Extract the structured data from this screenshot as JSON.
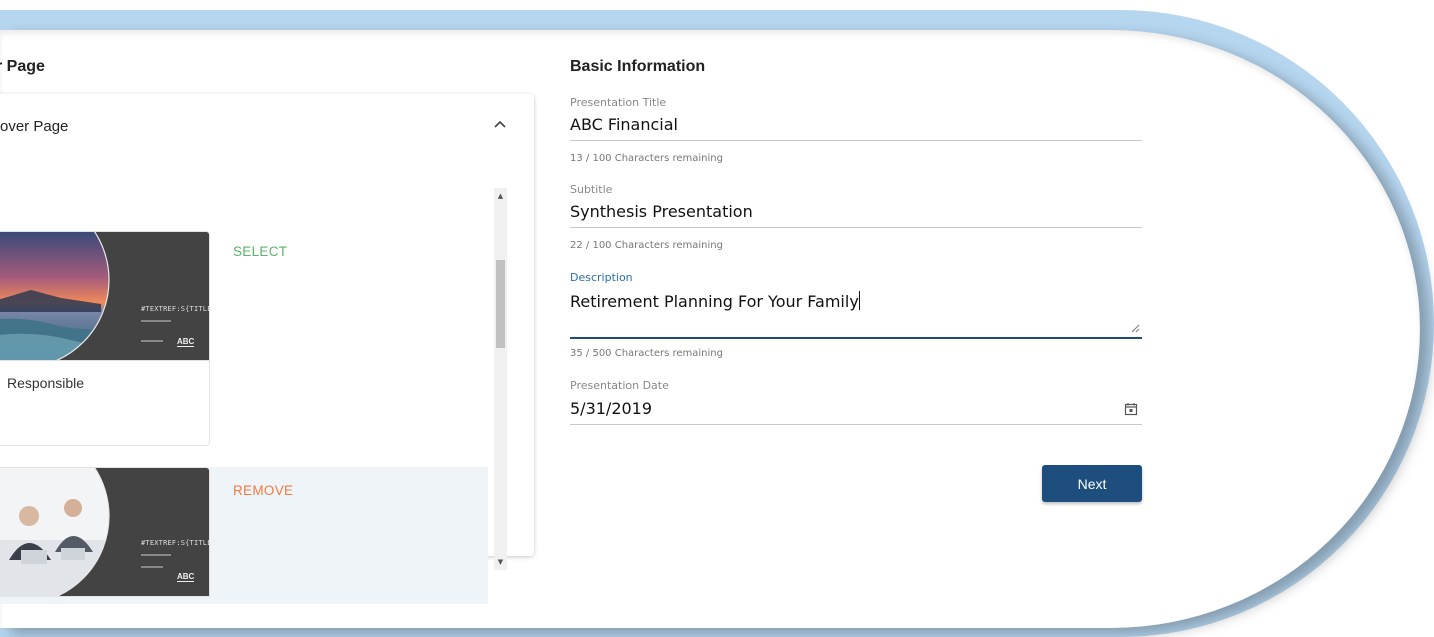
{
  "cover": {
    "section_title": "r Page",
    "panel_title": "over Page",
    "items": [
      {
        "action": "SELECT",
        "action_color": "#5cb36a",
        "caption": "Responsible",
        "thumb_code": "#TEXTREF:S{TITLE}",
        "thumb_logo": "ABC",
        "selected": false
      },
      {
        "action": "REMOVE",
        "action_color": "#f07b43",
        "caption": "",
        "thumb_code": "#TEXTREF:S{TITLE}",
        "thumb_logo": "ABC",
        "selected": true
      }
    ]
  },
  "form": {
    "section_title": "Basic Information",
    "presentation_title": {
      "label": "Presentation Title",
      "value": "ABC Financial",
      "helper": "13 / 100 Characters remaining"
    },
    "subtitle": {
      "label": "Subtitle",
      "value": "Synthesis Presentation",
      "helper": "22 / 100 Characters remaining"
    },
    "description": {
      "label": "Description",
      "value": "Retirement Planning For Your Family",
      "helper": "35 / 500 Characters remaining"
    },
    "presentation_date": {
      "label": "Presentation Date",
      "value": "5/31/2019"
    },
    "next_label": "Next"
  },
  "colors": {
    "frame": "#b6d6f0",
    "primary": "#1d4e7e",
    "active_label": "#2c6fa8",
    "select": "#5cb36a",
    "remove": "#f07b43",
    "selected_row": "#eef4f8"
  }
}
